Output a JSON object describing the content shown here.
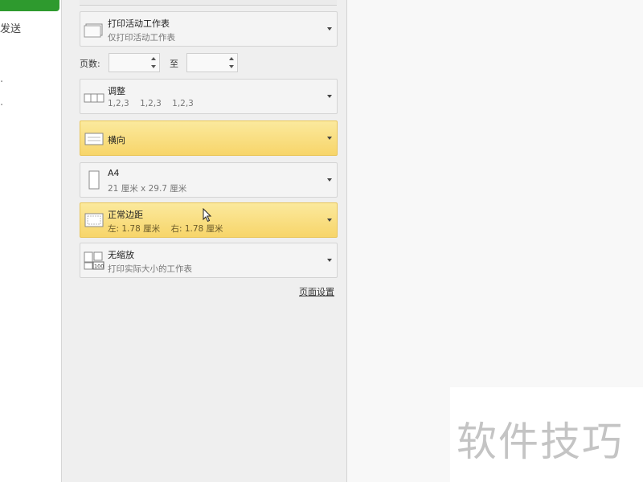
{
  "sidebar": {
    "items": [
      {
        "label": "发送"
      },
      {
        "label": "·"
      },
      {
        "label": "·"
      }
    ]
  },
  "print_settings": {
    "print_what": {
      "title": "打印活动工作表",
      "subtitle": "仅打印活动工作表"
    },
    "pages": {
      "label": "页数:",
      "to_label": "至",
      "from_value": "",
      "to_value": ""
    },
    "collation": {
      "title": "调整",
      "subtitle": "1,2,3    1,2,3    1,2,3"
    },
    "orientation": {
      "title": "横向"
    },
    "paper": {
      "title": "A4",
      "subtitle": "21 厘米 x 29.7 厘米"
    },
    "margins": {
      "title": "正常边距",
      "subtitle": "左: 1.78 厘米    右: 1.78 厘米"
    },
    "scaling": {
      "title": "无缩放",
      "subtitle": "打印实际大小的工作表"
    },
    "page_setup_link": "页面设置"
  },
  "watermark": {
    "text": "软件技巧"
  },
  "colors": {
    "accent": "#2e9a2e",
    "highlight": "#f7d56a"
  }
}
